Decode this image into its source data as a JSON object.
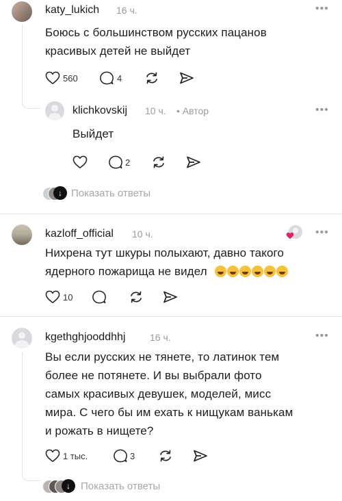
{
  "comments": [
    {
      "user": "katy_lukich",
      "time": "16 ч.",
      "text": [
        "Боюсь с большинством русских пацанов",
        "красивых детей не выйдет"
      ],
      "likes": "560",
      "replies": "4"
    },
    {
      "user": "klichkovskij",
      "time": "10 ч.",
      "author_badge": "• Автор",
      "text": [
        "Выйдет"
      ],
      "likes": "",
      "replies": "2"
    },
    {
      "user": "kazloff_official",
      "time": "10 ч.",
      "text": [
        "Нихрена тут шкуры полыхают, давно такого",
        "ядерного пожарища не видел"
      ],
      "emoji_count": 6,
      "likes": "10",
      "replies": ""
    },
    {
      "user": "kgethghjooddhhj",
      "time": "16 ч.",
      "text": [
        "Вы если русских не тянете, то латинок тем",
        "более не потянете. И вы выбрали фото",
        "самых красивых девушек, моделей, мисс",
        "мира. С чего бы им ехать к нищукам ванькам",
        "и рожать в нищете?"
      ],
      "likes": "1 тыс.",
      "replies": "3"
    }
  ],
  "show_replies_label": "Показать ответы",
  "more_label": "•••",
  "icons": [
    "avatar",
    "heart-icon",
    "comment-icon",
    "repost-icon",
    "share-icon",
    "more-icon",
    "author-liked-icon"
  ],
  "colors": {
    "liked_heart": "#e0245e",
    "muted": "#9a9a9a"
  }
}
